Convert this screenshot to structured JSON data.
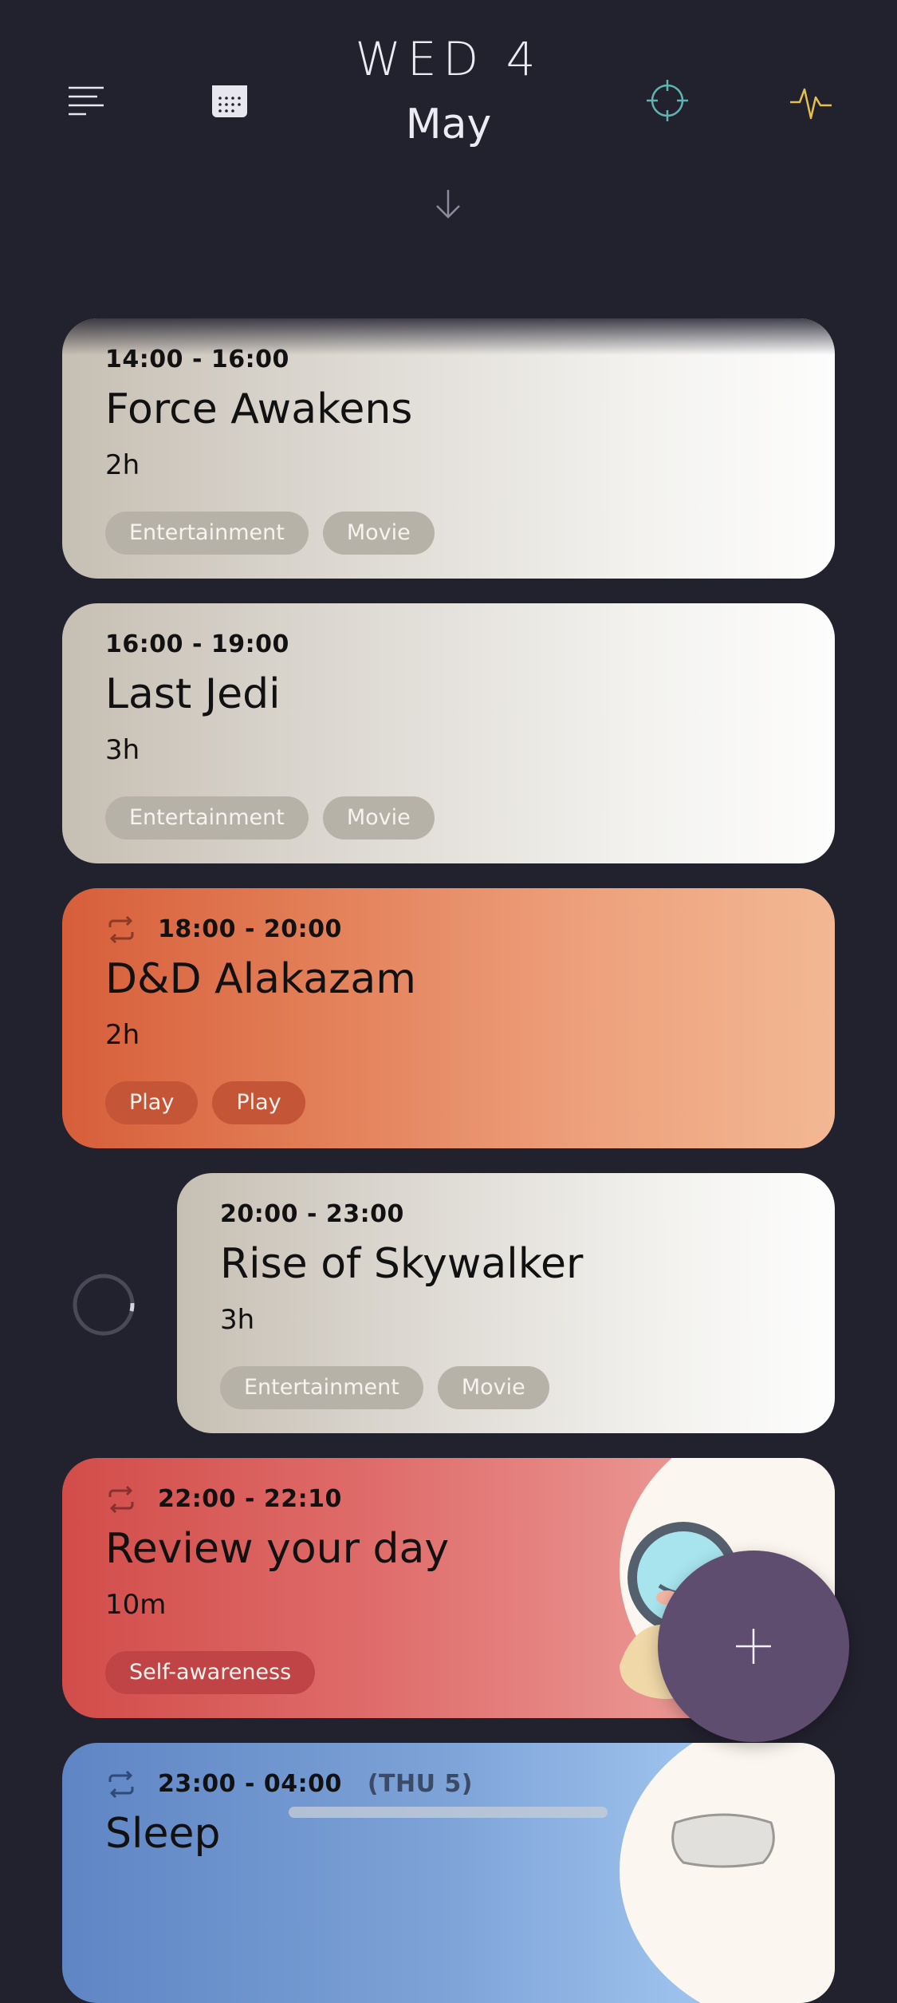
{
  "header": {
    "weekday": "WED 4",
    "month": "May",
    "icons": {
      "menu": "menu-lines-icon",
      "calendar": "calendar-icon",
      "target": "crosshair-icon",
      "pulse": "pulse-icon",
      "down": "arrow-down-icon"
    },
    "colors": {
      "target": "#5fb3b0",
      "pulse": "#e3c14a"
    }
  },
  "events": [
    {
      "time": "14:00 - 16:00",
      "title": "Force Awakens",
      "duration": "2h",
      "tags": [
        "Entertainment",
        "Movie"
      ],
      "color": "grey"
    },
    {
      "time": "16:00 - 19:00",
      "title": "Last Jedi",
      "duration": "3h",
      "tags": [
        "Entertainment",
        "Movie"
      ],
      "color": "grey"
    },
    {
      "time": "18:00 - 20:00",
      "title": "D&D Alakazam",
      "duration": "2h",
      "tags": [
        "Play",
        "Play"
      ],
      "color": "orange",
      "repeat": true
    },
    {
      "time": "20:00 - 23:00",
      "title": "Rise of Skywalker",
      "duration": "3h",
      "tags": [
        "Entertainment",
        "Movie"
      ],
      "color": "grey",
      "in_progress": true
    },
    {
      "time": "22:00 - 22:10",
      "title": "Review your day",
      "duration": "10m",
      "tags": [
        "Self-awareness"
      ],
      "color": "red",
      "repeat": true
    },
    {
      "time": "23:00 - 04:00",
      "time_extra": "(THU 5)",
      "title": "Sleep",
      "color": "blue",
      "repeat": true
    }
  ],
  "fab": {
    "icon": "plus-icon"
  }
}
